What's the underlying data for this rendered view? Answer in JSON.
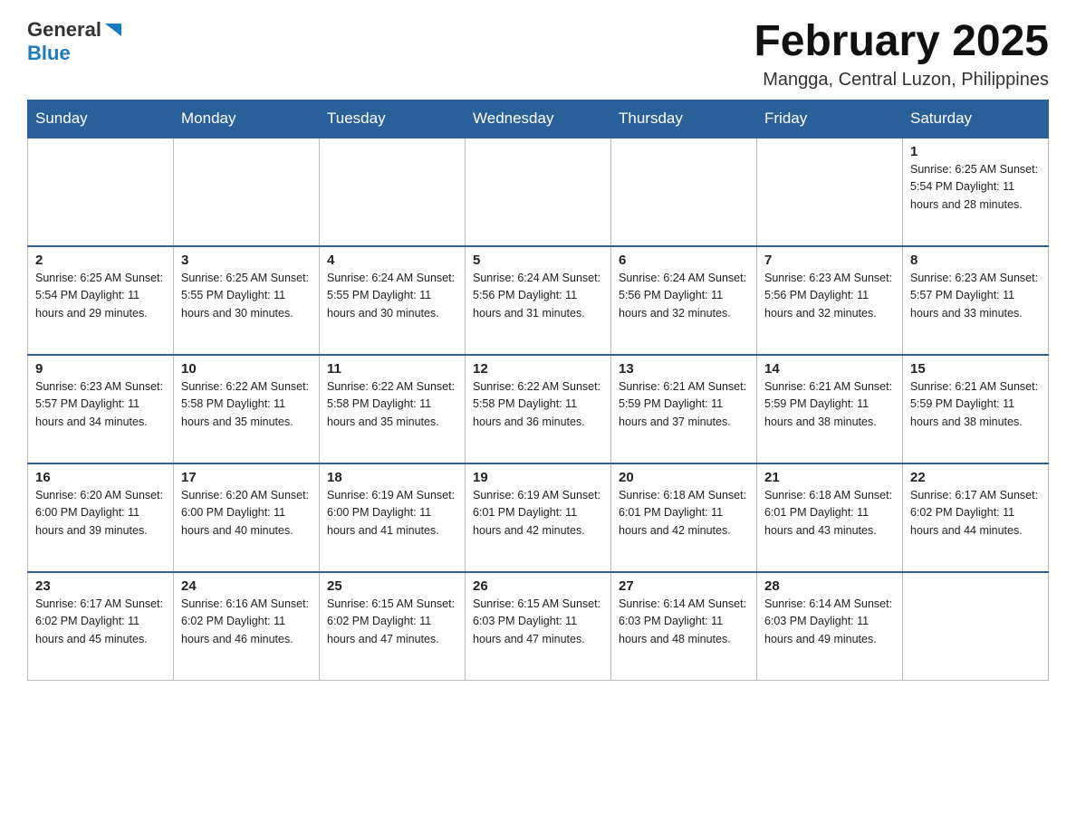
{
  "header": {
    "logo_general": "General",
    "logo_blue": "Blue",
    "title": "February 2025",
    "subtitle": "Mangga, Central Luzon, Philippines"
  },
  "days_of_week": [
    "Sunday",
    "Monday",
    "Tuesday",
    "Wednesday",
    "Thursday",
    "Friday",
    "Saturday"
  ],
  "weeks": [
    [
      {
        "day": "",
        "info": ""
      },
      {
        "day": "",
        "info": ""
      },
      {
        "day": "",
        "info": ""
      },
      {
        "day": "",
        "info": ""
      },
      {
        "day": "",
        "info": ""
      },
      {
        "day": "",
        "info": ""
      },
      {
        "day": "1",
        "info": "Sunrise: 6:25 AM\nSunset: 5:54 PM\nDaylight: 11 hours\nand 28 minutes."
      }
    ],
    [
      {
        "day": "2",
        "info": "Sunrise: 6:25 AM\nSunset: 5:54 PM\nDaylight: 11 hours\nand 29 minutes."
      },
      {
        "day": "3",
        "info": "Sunrise: 6:25 AM\nSunset: 5:55 PM\nDaylight: 11 hours\nand 30 minutes."
      },
      {
        "day": "4",
        "info": "Sunrise: 6:24 AM\nSunset: 5:55 PM\nDaylight: 11 hours\nand 30 minutes."
      },
      {
        "day": "5",
        "info": "Sunrise: 6:24 AM\nSunset: 5:56 PM\nDaylight: 11 hours\nand 31 minutes."
      },
      {
        "day": "6",
        "info": "Sunrise: 6:24 AM\nSunset: 5:56 PM\nDaylight: 11 hours\nand 32 minutes."
      },
      {
        "day": "7",
        "info": "Sunrise: 6:23 AM\nSunset: 5:56 PM\nDaylight: 11 hours\nand 32 minutes."
      },
      {
        "day": "8",
        "info": "Sunrise: 6:23 AM\nSunset: 5:57 PM\nDaylight: 11 hours\nand 33 minutes."
      }
    ],
    [
      {
        "day": "9",
        "info": "Sunrise: 6:23 AM\nSunset: 5:57 PM\nDaylight: 11 hours\nand 34 minutes."
      },
      {
        "day": "10",
        "info": "Sunrise: 6:22 AM\nSunset: 5:58 PM\nDaylight: 11 hours\nand 35 minutes."
      },
      {
        "day": "11",
        "info": "Sunrise: 6:22 AM\nSunset: 5:58 PM\nDaylight: 11 hours\nand 35 minutes."
      },
      {
        "day": "12",
        "info": "Sunrise: 6:22 AM\nSunset: 5:58 PM\nDaylight: 11 hours\nand 36 minutes."
      },
      {
        "day": "13",
        "info": "Sunrise: 6:21 AM\nSunset: 5:59 PM\nDaylight: 11 hours\nand 37 minutes."
      },
      {
        "day": "14",
        "info": "Sunrise: 6:21 AM\nSunset: 5:59 PM\nDaylight: 11 hours\nand 38 minutes."
      },
      {
        "day": "15",
        "info": "Sunrise: 6:21 AM\nSunset: 5:59 PM\nDaylight: 11 hours\nand 38 minutes."
      }
    ],
    [
      {
        "day": "16",
        "info": "Sunrise: 6:20 AM\nSunset: 6:00 PM\nDaylight: 11 hours\nand 39 minutes."
      },
      {
        "day": "17",
        "info": "Sunrise: 6:20 AM\nSunset: 6:00 PM\nDaylight: 11 hours\nand 40 minutes."
      },
      {
        "day": "18",
        "info": "Sunrise: 6:19 AM\nSunset: 6:00 PM\nDaylight: 11 hours\nand 41 minutes."
      },
      {
        "day": "19",
        "info": "Sunrise: 6:19 AM\nSunset: 6:01 PM\nDaylight: 11 hours\nand 42 minutes."
      },
      {
        "day": "20",
        "info": "Sunrise: 6:18 AM\nSunset: 6:01 PM\nDaylight: 11 hours\nand 42 minutes."
      },
      {
        "day": "21",
        "info": "Sunrise: 6:18 AM\nSunset: 6:01 PM\nDaylight: 11 hours\nand 43 minutes."
      },
      {
        "day": "22",
        "info": "Sunrise: 6:17 AM\nSunset: 6:02 PM\nDaylight: 11 hours\nand 44 minutes."
      }
    ],
    [
      {
        "day": "23",
        "info": "Sunrise: 6:17 AM\nSunset: 6:02 PM\nDaylight: 11 hours\nand 45 minutes."
      },
      {
        "day": "24",
        "info": "Sunrise: 6:16 AM\nSunset: 6:02 PM\nDaylight: 11 hours\nand 46 minutes."
      },
      {
        "day": "25",
        "info": "Sunrise: 6:15 AM\nSunset: 6:02 PM\nDaylight: 11 hours\nand 47 minutes."
      },
      {
        "day": "26",
        "info": "Sunrise: 6:15 AM\nSunset: 6:03 PM\nDaylight: 11 hours\nand 47 minutes."
      },
      {
        "day": "27",
        "info": "Sunrise: 6:14 AM\nSunset: 6:03 PM\nDaylight: 11 hours\nand 48 minutes."
      },
      {
        "day": "28",
        "info": "Sunrise: 6:14 AM\nSunset: 6:03 PM\nDaylight: 11 hours\nand 49 minutes."
      },
      {
        "day": "",
        "info": ""
      }
    ]
  ]
}
